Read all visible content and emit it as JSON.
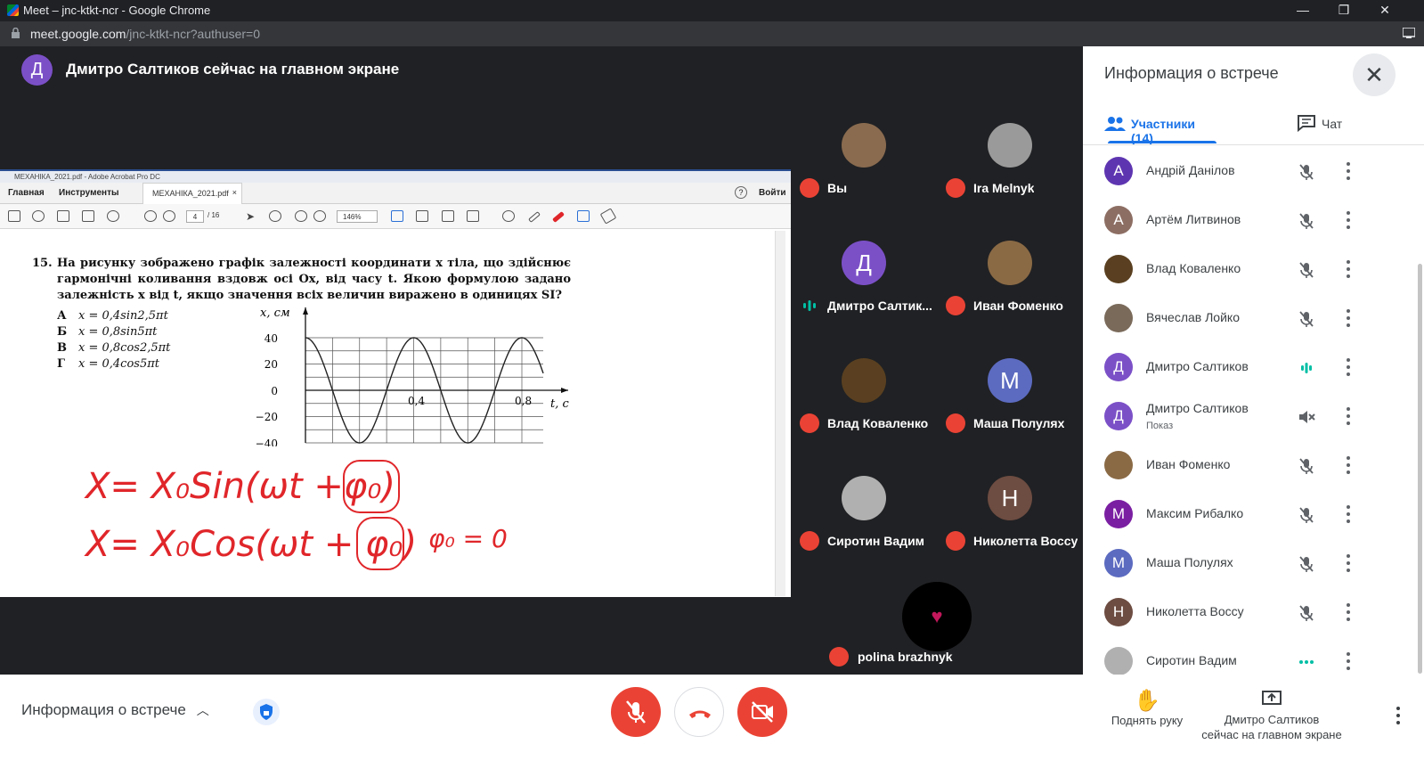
{
  "browser": {
    "window_title": "Meet – jnc-ktkt-ncr - Google Chrome",
    "url_host": "meet.google.com",
    "url_path": "/jnc-ktkt-ncr?authuser=0",
    "window_controls": [
      "minimize-icon",
      "restore-icon",
      "close-icon"
    ]
  },
  "banner": {
    "avatar_letter": "Д",
    "text": "Дмитро Салтиков сейчас на главном экране"
  },
  "acrobat": {
    "window_title": "МЕХАНІКА_2021.pdf - Adobe Acrobat Pro DC",
    "tab_home": "Главная",
    "tab_tools": "Инструменты",
    "doc_tab": "МЕХАНІКА_2021.pdf",
    "login": "Войти",
    "page_current": "4",
    "page_total": "/ 16",
    "zoom": "146%"
  },
  "document": {
    "question_number": "15.",
    "question_text": "На рисунку зображено графік залежності координати x тіла, що здійснює гармонічні коливання вздовж осі Ox, від часу t. Якою формулою задано залежність x від t, якщо значення всіх величин виражено в одиницях SI?",
    "options": [
      {
        "letter": "А",
        "formula": "x = 0,4sin2,5πt"
      },
      {
        "letter": "Б",
        "formula": "x = 0,8sin5πt"
      },
      {
        "letter": "В",
        "formula": "x = 0,8cos2,5πt"
      },
      {
        "letter": "Г",
        "formula": "x = 0,4cos5πt"
      }
    ],
    "graph": {
      "y_label": "x, см",
      "x_label": "t, c",
      "y_ticks": [
        "40",
        "20",
        "0",
        "−20",
        "−40"
      ],
      "x_ticks": [
        "0,4",
        "0,8"
      ]
    },
    "handwriting": {
      "line1": "X= X₀Sin(ωt +φ₀)",
      "line2": "X= X₀Cos(ωt + φ₀)",
      "note": "φ₀ = 0"
    }
  },
  "chart_data": {
    "type": "line",
    "title": "",
    "xlabel": "t, c",
    "ylabel": "x, см",
    "xlim": [
      0,
      0.9
    ],
    "ylim": [
      -40,
      40
    ],
    "x_ticks": [
      0.4,
      0.8
    ],
    "y_ticks": [
      -40,
      -20,
      0,
      20,
      40
    ],
    "grid": true,
    "series": [
      {
        "function": "x = 40·cos(5πt)",
        "amplitude": 40,
        "period": 0.4,
        "x_range": [
          0,
          0.9
        ]
      }
    ]
  },
  "tiles": [
    {
      "name": "Вы",
      "muted": true,
      "avatar": "photo",
      "color": "#8a6b4f"
    },
    {
      "name": "Ira Melnyk",
      "muted": true,
      "avatar": "photo",
      "color": "#9a9a9a"
    },
    {
      "name": "Дмитро Салтик...",
      "muted": false,
      "avatar": "letter",
      "letter": "Д",
      "color": "#7b50c7"
    },
    {
      "name": "Иван Фоменко",
      "muted": true,
      "avatar": "photo",
      "color": "#8a6a45"
    },
    {
      "name": "Влад Коваленко",
      "muted": true,
      "avatar": "photo",
      "color": "#5a4020"
    },
    {
      "name": "Маша Полулях",
      "muted": true,
      "avatar": "letter",
      "letter": "M",
      "color": "#5c6bc0"
    },
    {
      "name": "Сиротин Вадим",
      "muted": true,
      "avatar": "photo",
      "color": "#b0b0b0"
    },
    {
      "name": "Николетта Воссу",
      "muted": true,
      "avatar": "letter",
      "letter": "Н",
      "color": "#6d4c41"
    }
  ],
  "tile_polina": {
    "name": "polina brazhnyk",
    "muted": true
  },
  "panel": {
    "title": "Информация о встрече",
    "tab_people": "Участники (14)",
    "tab_chat": "Чат",
    "participants": [
      {
        "name": "Андрій Данілов",
        "avatar": "letter",
        "letter": "А",
        "color": "#5e35b1",
        "status": "muted"
      },
      {
        "name": "Артём Литвинов",
        "avatar": "letter",
        "letter": "А",
        "color": "#8d6e63",
        "status": "muted"
      },
      {
        "name": "Влад Коваленко",
        "avatar": "photo",
        "color": "#5a4020",
        "status": "muted"
      },
      {
        "name": "Вячеслав Лойко",
        "avatar": "photo",
        "color": "#7a6a5a",
        "status": "muted"
      },
      {
        "name": "Дмитро Салтиков",
        "avatar": "letter",
        "letter": "Д",
        "color": "#7b50c7",
        "status": "speaking"
      },
      {
        "name": "Дмитро Салтиков",
        "sub": "Показ",
        "avatar": "letter",
        "letter": "Д",
        "color": "#7b50c7",
        "status": "presentation-muted"
      },
      {
        "name": "Иван Фоменко",
        "avatar": "photo",
        "color": "#8a6a45",
        "status": "muted"
      },
      {
        "name": "Максим Рибалко",
        "avatar": "letter",
        "letter": "M",
        "color": "#7b1fa2",
        "status": "muted"
      },
      {
        "name": "Маша Полулях",
        "avatar": "letter",
        "letter": "M",
        "color": "#5c6bc0",
        "status": "muted"
      },
      {
        "name": "Николетта Воссу",
        "avatar": "letter",
        "letter": "Н",
        "color": "#6d4c41",
        "status": "muted"
      },
      {
        "name": "Сиротин Вадим",
        "avatar": "photo",
        "color": "#b0b0b0",
        "status": "active"
      }
    ]
  },
  "bottom": {
    "meeting_info": "Информация о встрече",
    "raise_hand": "Поднять руку",
    "present_line1": "Дмитро Салтиков",
    "present_line2": "сейчас на главном экране"
  },
  "colors": {
    "accent": "#1a73e8",
    "danger": "#ea4335",
    "speaking": "#00bfa5",
    "ink": "#e0262a"
  }
}
